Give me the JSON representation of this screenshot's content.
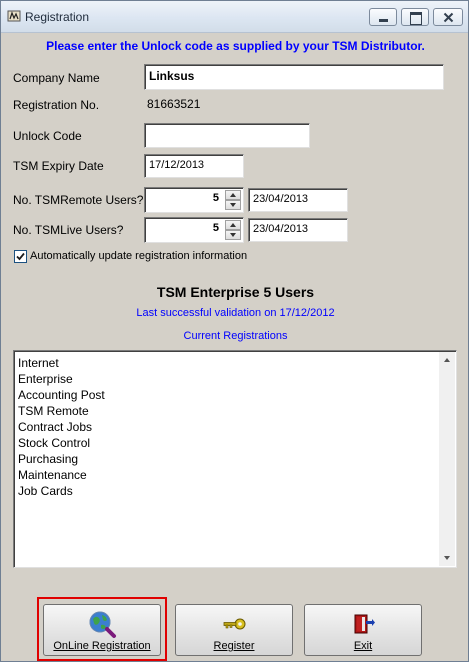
{
  "window": {
    "title": "Registration"
  },
  "instruction": "Please enter the Unlock code as supplied by your TSM Distributor.",
  "form": {
    "company_name": {
      "label": "Company Name",
      "value": "Linksus"
    },
    "registration_no": {
      "label": "Registration No.",
      "value": "81663521"
    },
    "unlock_code": {
      "label": "Unlock Code",
      "value": ""
    },
    "expiry_date": {
      "label": "TSM Expiry Date",
      "value": "17/12/2013"
    },
    "remote_users": {
      "label": "No. TSMRemote Users?",
      "count": "5",
      "date": "23/04/2013"
    },
    "live_users": {
      "label": "No. TSMLive Users?",
      "count": "5",
      "date": "23/04/2013"
    },
    "auto_update": {
      "label": "Automatically update registration information",
      "checked": true
    }
  },
  "summary": {
    "heading": "TSM Enterprise 5 Users",
    "last_validation": "Last successful validation on 17/12/2012",
    "current_registrations_label": "Current Registrations"
  },
  "registrations": [
    "Internet",
    "Enterprise",
    "Accounting Post",
    "TSM Remote",
    "Contract Jobs",
    "Stock Control",
    "Purchasing",
    "Maintenance",
    "Job Cards"
  ],
  "buttons": {
    "online": {
      "label": "OnLine Registration",
      "icon": "globe-magnifier-icon"
    },
    "register": {
      "label": "Register",
      "icon": "key-icon"
    },
    "exit": {
      "label": "Exit",
      "icon": "exit-door-icon"
    }
  },
  "colors": {
    "accent_text": "#0000ff",
    "highlight_border": "#e00000",
    "dialog_background": "#d4d0c8"
  }
}
